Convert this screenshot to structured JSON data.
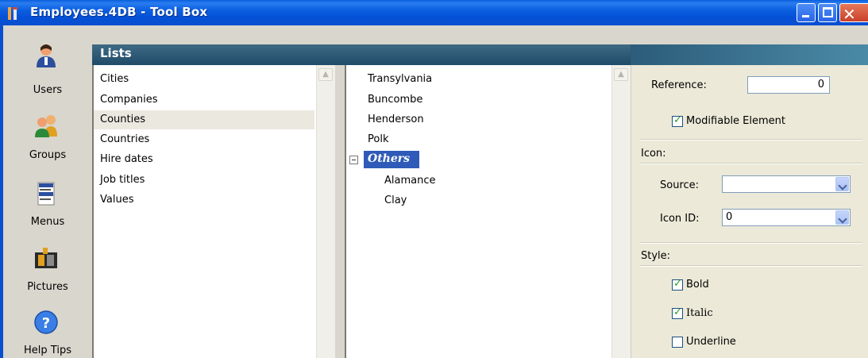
{
  "window": {
    "title": "Employees.4DB - Tool Box",
    "icon": "toolbox-app-icon"
  },
  "nav": {
    "items": [
      {
        "label": "Users",
        "icon": "user-icon"
      },
      {
        "label": "Groups",
        "icon": "groups-icon"
      },
      {
        "label": "Menus",
        "icon": "menus-icon"
      },
      {
        "label": "Pictures",
        "icon": "film-pictures-icon"
      },
      {
        "label": "Help Tips",
        "icon": "help-icon"
      }
    ]
  },
  "section": {
    "title": "Lists"
  },
  "lists": {
    "items": [
      "Cities",
      "Companies",
      "Counties",
      "Countries",
      "Hire dates",
      "Job titles",
      "Values"
    ],
    "selected": "Counties"
  },
  "elements": {
    "items": [
      "Transylvania",
      "Buncombe",
      "Henderson",
      "Polk"
    ],
    "group": {
      "label": "Others",
      "children": [
        "Alamance",
        "Clay"
      ]
    }
  },
  "properties": {
    "reference_label": "Reference:",
    "reference_value": "0",
    "modifiable_label": "Modifiable Element",
    "modifiable_checked": true,
    "icon_section": "Icon:",
    "source_label": "Source:",
    "source_value": "",
    "icon_id_label": "Icon ID:",
    "icon_id_value": "0",
    "style_section": "Style:",
    "bold_label": "Bold",
    "bold_checked": true,
    "italic_label": "Italic",
    "italic_checked": true,
    "underline_label": "Underline",
    "underline_checked": false
  },
  "colors": {
    "title_bar": "#0a5fdc",
    "header_band": "#1f4b6a",
    "selection": "#2f5ab8",
    "nav_bg": "#d9d6cd",
    "props_bg": "#ece9d8"
  }
}
